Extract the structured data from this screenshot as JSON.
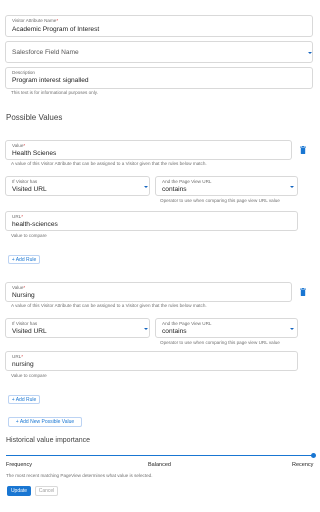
{
  "name_field": {
    "label": "Visitor Attribute Name",
    "required_mark": "*",
    "value": "Academic Program of Interest"
  },
  "sf_field": {
    "placeholder": "Salesforce Field Name"
  },
  "description": {
    "label": "Description",
    "value": "Program interest signalled",
    "helper": "This text is for informational purposes only."
  },
  "possible_values_title": "Possible Values",
  "values": [
    {
      "value_label": "Value",
      "required_mark": "*",
      "value": "Health Scienes",
      "value_helper": "A value of this Visitor Attribute that can be assigned to a Visitor given that the rules below match.",
      "if_label": "If Visitor has",
      "if_value": "Visited URL",
      "and_label": "And the Page View URL",
      "and_value": "contains",
      "and_helper": "Operator to use when comparing this page view URL value",
      "url_label": "URL",
      "url_value": "health-sciences",
      "url_helper": "Value to compare",
      "add_rule": "+ Add Rule"
    },
    {
      "value_label": "Value",
      "required_mark": "*",
      "value": "Nursing",
      "value_helper": "A value of this Visitor Attribute that can be assigned to a Visitor given that the rules below match.",
      "if_label": "If Visitor has",
      "if_value": "Visited URL",
      "and_label": "And the Page View URL",
      "and_value": "contains",
      "and_helper": "Operator to use when comparing this page view URL value",
      "url_label": "URL",
      "url_value": "nursing",
      "url_helper": "Value to compare",
      "add_rule": "+ Add Rule"
    }
  ],
  "add_possible_value": "+ Add New Possible Value",
  "historical": {
    "title": "Historical value importance",
    "left": "Frequency",
    "middle": "Balanced",
    "right": "Recency",
    "level": 1.0,
    "helper": "The most recent matching PageView determines what value is selected."
  },
  "actions": {
    "update": "Update",
    "cancel": "Cancel"
  },
  "colors": {
    "accent": "#1976d2",
    "required": "#d32f2f"
  }
}
